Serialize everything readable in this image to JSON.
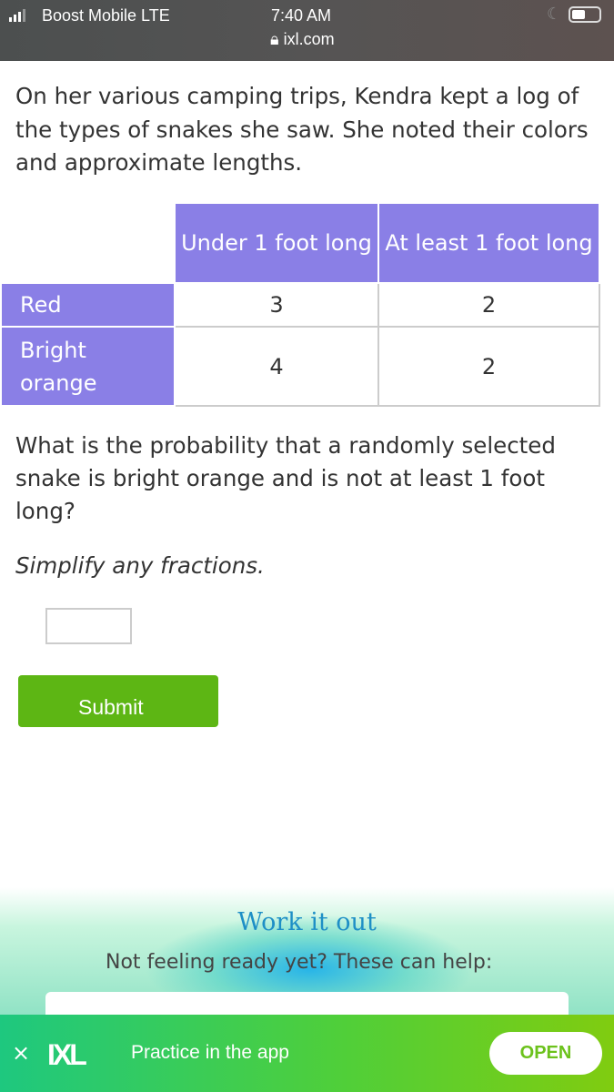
{
  "status_bar": {
    "carrier": "Boost Mobile  LTE",
    "time": "7:40 AM",
    "url": "ixl.com"
  },
  "question": {
    "intro": "On her various camping trips, Kendra kept a log of the types of snakes she saw. She noted their colors and approximate lengths.",
    "table": {
      "columns": [
        "Under 1 foot long",
        "At least 1 foot long"
      ],
      "rows": [
        {
          "label": "Red",
          "values": [
            "3",
            "2"
          ]
        },
        {
          "label": "Bright orange",
          "values": [
            "4",
            "2"
          ]
        }
      ]
    },
    "prompt": "What is the probability that a randomly selected snake is bright orange and is not at least 1 foot long?",
    "instruction": "Simplify any fractions.",
    "answer_value": "",
    "submit_label": "Submit"
  },
  "help": {
    "title": "Work it out",
    "subtitle": "Not feeling ready yet? These can help:"
  },
  "app_banner": {
    "close": "×",
    "logo": "IXL",
    "text": "Practice in the app",
    "open_label": "OPEN"
  },
  "colors": {
    "table_header": "#8a7fe6",
    "submit": "#5db614",
    "title": "#1e8fc6"
  }
}
